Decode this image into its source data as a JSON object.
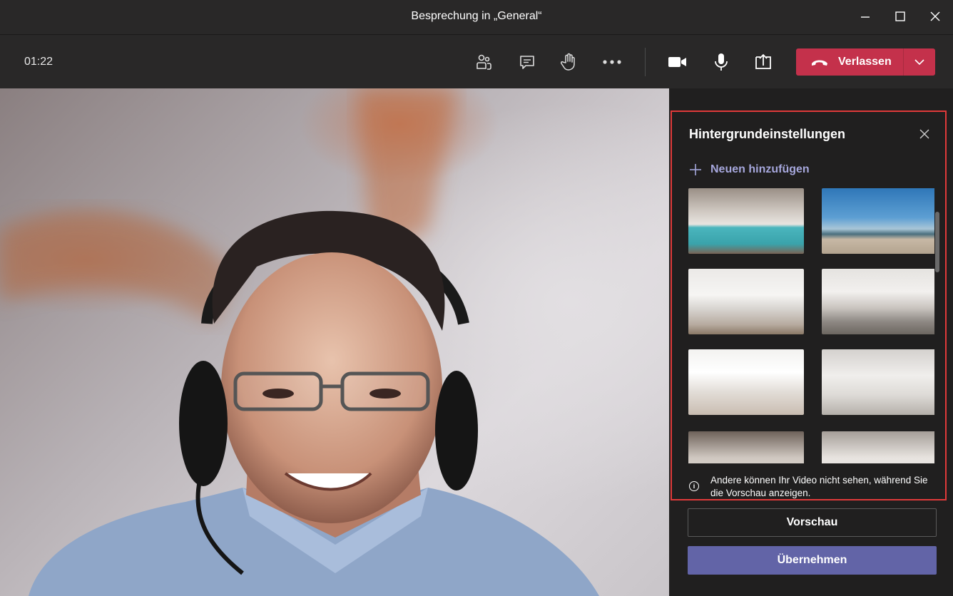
{
  "window": {
    "title": "Besprechung in „General“"
  },
  "toolbar": {
    "timer": "01:22",
    "icons": [
      "people-icon",
      "chat-icon",
      "raise-hand-icon",
      "more-icon",
      "camera-icon",
      "microphone-icon",
      "share-screen-icon"
    ],
    "leave_label": "Verlassen",
    "leave_color": "#c4314b"
  },
  "panel": {
    "title": "Hintergrundeinstellungen",
    "add_new_label": "Neuen hinzufügen",
    "info_text": "Andere können Ihr Video nicht sehen, während Sie die Vorschau anzeigen.",
    "preview_label": "Vorschau",
    "apply_label": "Übernehmen",
    "apply_color": "#6264a7",
    "highlight_color": "#e03a3a"
  }
}
